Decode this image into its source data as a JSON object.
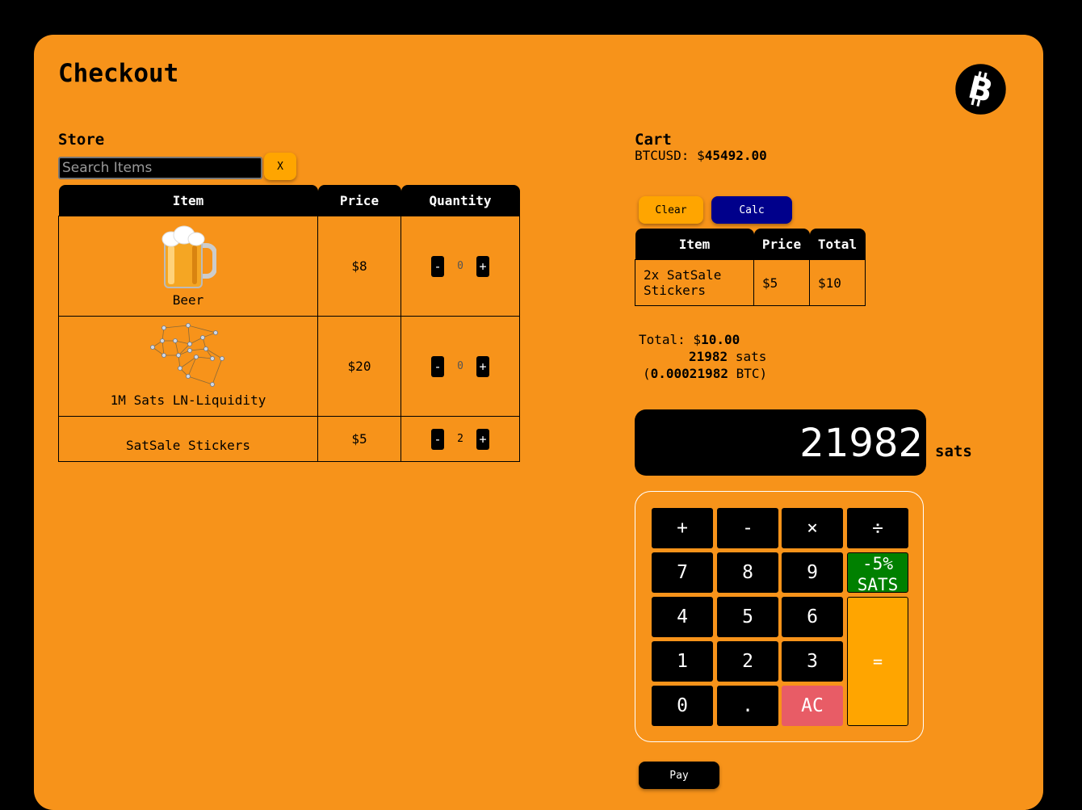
{
  "page": {
    "title": "Checkout"
  },
  "colors": {
    "panel": "#f7931a",
    "accent": "#ffa500",
    "calc_button": "#00008b",
    "discount": "#008000",
    "clear_key": "#e85c66"
  },
  "store": {
    "label": "Store",
    "search_placeholder": "Search Items",
    "search_clear_label": "X",
    "columns": [
      "Item",
      "Price",
      "Quantity"
    ],
    "rows": [
      {
        "name": "Beer",
        "price": "$8",
        "quantity": "0",
        "icon": "beer-mug-icon"
      },
      {
        "name": "1M Sats LN-Liquidity",
        "price": "$20",
        "quantity": "0",
        "icon": "network-graph-icon"
      },
      {
        "name": "SatSale Stickers",
        "price": "$5",
        "quantity": "2",
        "icon": ""
      }
    ],
    "minus_label": "-",
    "plus_label": "+"
  },
  "cart": {
    "label": "Cart",
    "rate_label": "BTCUSD: $",
    "rate_value": "45492.00",
    "clear_label": "Clear",
    "calc_label": "Calc",
    "columns": [
      "Item",
      "Price",
      "Total"
    ],
    "rows": [
      {
        "item": "2x SatSale Stickers",
        "price": "$5",
        "total": "$10"
      }
    ],
    "total_label": "Total: $",
    "total_value": "10.00",
    "sats_value": "21982",
    "sats_unit": "sats",
    "btc_open": "(",
    "btc_value": "0.00021982",
    "btc_close": "BTC)"
  },
  "calculator": {
    "display_value": "21982",
    "display_unit": "sats",
    "keys": {
      "plus": "+",
      "minus": "-",
      "times": "×",
      "divide": "÷",
      "seven": "7",
      "eight": "8",
      "nine": "9",
      "discount_line1": "-5%",
      "discount_line2": "SATS",
      "four": "4",
      "five": "5",
      "six": "6",
      "one": "1",
      "two": "2",
      "three": "3",
      "equals": "=",
      "zero": "0",
      "dot": ".",
      "clear": "AC"
    }
  },
  "pay": {
    "label": "Pay"
  }
}
